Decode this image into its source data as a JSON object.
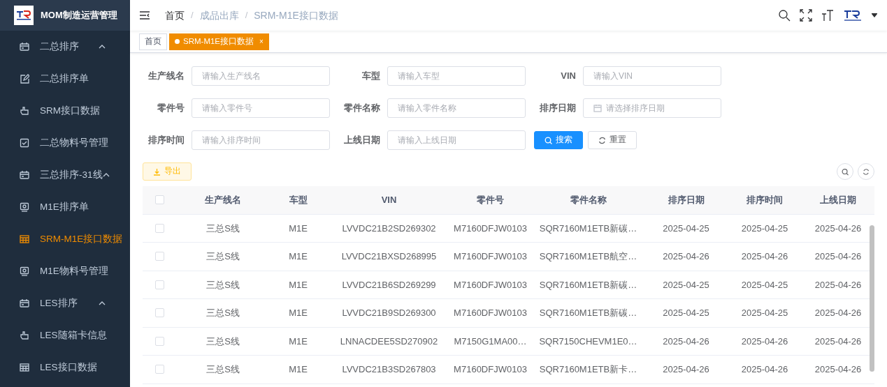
{
  "app": {
    "title": "MOM制造运营管理"
  },
  "sidebar": {
    "items": [
      {
        "kind": "group",
        "label": "二总排序",
        "expanded": true,
        "selected": false
      },
      {
        "kind": "page",
        "label": "二总排序单",
        "selected": false
      },
      {
        "kind": "page",
        "label": "SRM接口数据",
        "selected": false
      },
      {
        "kind": "page",
        "label": "二总物料号管理",
        "selected": false
      },
      {
        "kind": "group",
        "label": "三总排序-31线",
        "expanded": true,
        "selected": false
      },
      {
        "kind": "page",
        "label": "M1E排序单",
        "selected": false
      },
      {
        "kind": "page",
        "label": "SRM-M1E接口数据",
        "selected": true
      },
      {
        "kind": "page",
        "label": "M1E物料号管理",
        "selected": false
      },
      {
        "kind": "group",
        "label": "LES排序",
        "expanded": true,
        "selected": false
      },
      {
        "kind": "page",
        "label": "LES随箱卡信息",
        "selected": false
      },
      {
        "kind": "page",
        "label": "LES接口数据",
        "selected": false
      }
    ]
  },
  "breadcrumb": [
    {
      "label": "首页"
    },
    {
      "separator": "/",
      "label": "成品出库"
    },
    {
      "separator": "/",
      "label": "SRM-M1E接口数据"
    }
  ],
  "tabs": [
    {
      "label": "首页",
      "selected": false
    },
    {
      "label": "SRM-M1E接口数据",
      "selected": true,
      "close": "×"
    }
  ],
  "filters": [
    {
      "label": "生产线名",
      "placeholder": "请输入生产线名",
      "kind": "text"
    },
    {
      "label": "车型",
      "placeholder": "请输入车型",
      "kind": "text"
    },
    {
      "label": "VIN",
      "placeholder": "请输入VIN",
      "kind": "text"
    },
    {
      "label": "零件号",
      "placeholder": "请输入零件号",
      "kind": "text"
    },
    {
      "label": "零件名称",
      "placeholder": "请输入零件名称",
      "kind": "text"
    },
    {
      "label": "排序日期",
      "placeholder": "请选择排序日期",
      "kind": "date"
    },
    {
      "label": "排序时间",
      "placeholder": "请输入排序时间",
      "kind": "text"
    },
    {
      "label": "上线日期",
      "placeholder": "请输入上线日期",
      "kind": "text"
    }
  ],
  "buttons": {
    "search": "搜索",
    "reset": "重置",
    "export": "导出"
  },
  "table": {
    "header_checked": false,
    "columns": [
      "生产线名",
      "车型",
      "VIN",
      "零件号",
      "零件名称",
      "排序日期",
      "排序时间",
      "上线日期"
    ],
    "rows": [
      {
        "checked": false,
        "cells": [
          "三总S线",
          "M1E",
          "LVVDC21B2SD269302",
          "M7160DFJW0103",
          "SQR7160M1ETB新碳…",
          "2025-04-25",
          "2025-04-25",
          "2025-04-26"
        ]
      },
      {
        "checked": false,
        "cells": [
          "三总S线",
          "M1E",
          "LVVDC21BXSD268995",
          "M7160DFJW0103",
          "SQR7160M1ETB航空…",
          "2025-04-26",
          "2025-04-26",
          "2025-04-26"
        ]
      },
      {
        "checked": false,
        "cells": [
          "三总S线",
          "M1E",
          "LVVDC21B6SD269299",
          "M7160DFJW0103",
          "SQR7160M1ETB新碳…",
          "2025-04-25",
          "2025-04-25",
          "2025-04-26"
        ]
      },
      {
        "checked": false,
        "cells": [
          "三总S线",
          "M1E",
          "LVVDC21B9SD269300",
          "M7160DFJW0103",
          "SQR7160M1ETB新碳…",
          "2025-04-25",
          "2025-04-25",
          "2025-04-26"
        ]
      },
      {
        "checked": false,
        "cells": [
          "三总S线",
          "M1E",
          "LNNACDEE5SD270902",
          "M7150G1MA00…",
          "SQR7150CHEVM1E0…",
          "2025-04-26",
          "2025-04-26",
          "2025-04-26"
        ]
      },
      {
        "checked": false,
        "cells": [
          "三总S线",
          "M1E",
          "LVVDC21B3SD267803",
          "M7160DFJW0103",
          "SQR7160M1ETB新卡…",
          "2025-04-26",
          "2025-04-26",
          "2025-04-26"
        ]
      }
    ]
  }
}
